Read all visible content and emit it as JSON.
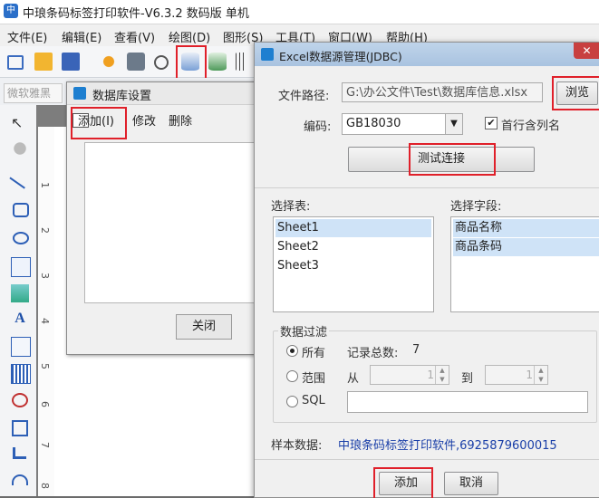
{
  "app": {
    "title": "中琅条码标签打印软件-V6.3.2 数码版 单机",
    "logo": "中"
  },
  "menu": [
    "文件(E)",
    "编辑(E)",
    "查看(V)",
    "绘图(D)",
    "图形(S)",
    "工具(T)",
    "窗口(W)",
    "帮助(H)"
  ],
  "toolbar": {
    "font_field": "微软雅黑"
  },
  "ruler_ticks": [
    "1",
    "2",
    "3",
    "4",
    "5",
    "6",
    "7",
    "8"
  ],
  "db_dialog": {
    "title": "数据库设置",
    "add_label": "添加(I)",
    "edit_label": "修改",
    "delete_label": "删除",
    "close_label": "关闭"
  },
  "excel_dialog": {
    "title": "Excel数据源管理(JDBC)",
    "close_glyph": "✕",
    "file_path_label": "文件路径:",
    "file_path_value": "G:\\办公文件\\Test\\数据库信息.xlsx",
    "browse_label": "浏览",
    "encoding_label": "编码:",
    "encoding_value": "GB18030",
    "first_row_header_label": "首行含列名",
    "first_row_header_checked": true,
    "test_connection_label": "测试连接",
    "select_table_label": "选择表:",
    "tables": [
      "Sheet1",
      "Sheet2",
      "Sheet3"
    ],
    "selected_table": "Sheet1",
    "select_fields_label": "选择字段:",
    "fields": [
      "商品名称",
      "商品条码"
    ],
    "filter_label": "数据过滤",
    "filter_all_label": "所有",
    "record_total_label": "记录总数:",
    "record_total_value": "7",
    "filter_range_label": "范围",
    "range_from_label": "从",
    "range_from_value": "1",
    "range_to_label": "到",
    "range_to_value": "1",
    "filter_sql_label": "SQL",
    "sample_label": "样本数据:",
    "sample_value": "中琅条码标签打印软件,6925879600015",
    "add_label": "添加",
    "cancel_label": "取消"
  },
  "colors": {
    "highlight_red": "#e0202a",
    "list_selection": "#cfe3f7",
    "sample_text": "#1a3fa8"
  }
}
